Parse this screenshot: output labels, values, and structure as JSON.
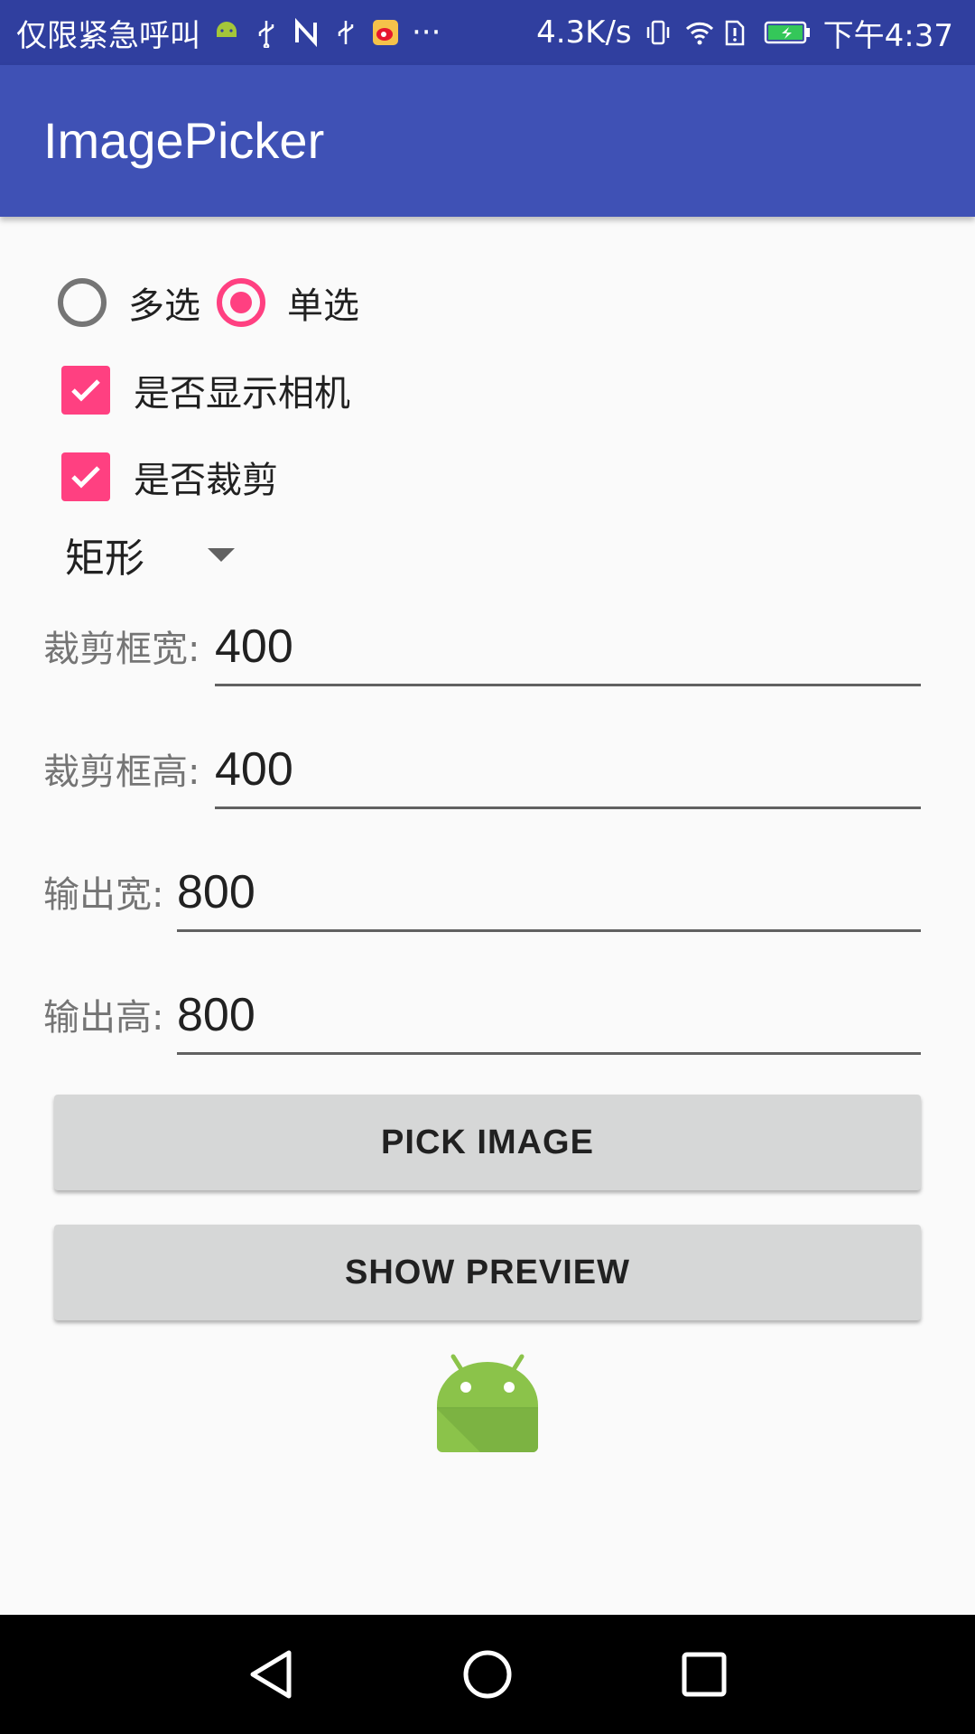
{
  "status_bar": {
    "carrier": "仅限紧急呼叫",
    "notification_icons": [
      "android-icon",
      "usb-icon",
      "n-icon",
      "usb-icon",
      "weibo-icon"
    ],
    "more": "···",
    "speed": "4.3K/s",
    "time": "下午4:37"
  },
  "app_bar": {
    "title": "ImagePicker"
  },
  "select_mode": {
    "options": [
      {
        "label": "多选",
        "checked": false
      },
      {
        "label": "单选",
        "checked": true
      }
    ]
  },
  "options": {
    "show_camera": {
      "label": "是否显示相机",
      "checked": true
    },
    "crop": {
      "label": "是否裁剪",
      "checked": true
    }
  },
  "crop_style": {
    "selected": "矩形"
  },
  "fields": {
    "crop_width": {
      "label": "裁剪框宽:",
      "value": "400"
    },
    "crop_height": {
      "label": "裁剪框高:",
      "value": "400"
    },
    "output_width": {
      "label": "输出宽:",
      "value": "800"
    },
    "output_height": {
      "label": "输出高:",
      "value": "800"
    }
  },
  "buttons": {
    "pick_image": "PICK IMAGE",
    "show_preview": "SHOW PREVIEW"
  },
  "colors": {
    "primary": "#3f51b5",
    "primary_dark": "#303f9f",
    "accent": "#ff4081",
    "android_green": "#8bc34a"
  }
}
